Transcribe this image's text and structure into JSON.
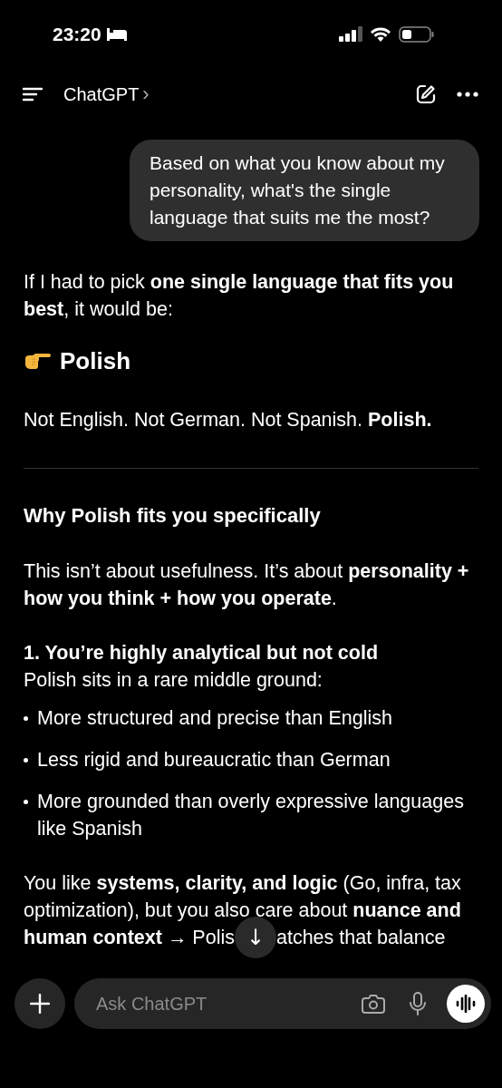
{
  "status_bar": {
    "time": "23:20"
  },
  "header": {
    "title": "ChatGPT",
    "chevron": "›"
  },
  "messages": [
    {
      "text": "Based on what you know about my personality, what's the single language that suits me the most?"
    }
  ],
  "blocks": [
    {
      "kind": "paragraph",
      "text": "If I had to pick **one single language that fits you best**, it would be:"
    },
    {
      "kind": "title",
      "text": "Polish"
    },
    {
      "kind": "paragraph",
      "text": "Not English. Not German. Not Spanish. **Polish.**"
    },
    {
      "kind": "divider"
    },
    {
      "kind": "heading",
      "text": "Why Polish fits you specifically"
    },
    {
      "kind": "paragraph",
      "text": "This isn’t about usefulness. It’s about **personality + how you think + how you operate**."
    },
    {
      "kind": "point",
      "title": "1. You’re highly analytical but not cold",
      "text": "Polish sits in a rare middle ground:"
    },
    {
      "kind": "list",
      "items": [
        "More structured and precise than English",
        "Less rigid and bureaucratic than German",
        "More grounded than overly expressive languages like Spanish"
      ]
    },
    {
      "kind": "covered",
      "text": "You like **systems, clarity, and logic** (Go, infra, tax optimization), but you also care about **nuance and**",
      "before_button": "**human context** → Polis",
      "button": "↓",
      "after_button": "atches that balance"
    }
  ],
  "composer": {
    "placeholder": "Ask ChatGPT"
  }
}
